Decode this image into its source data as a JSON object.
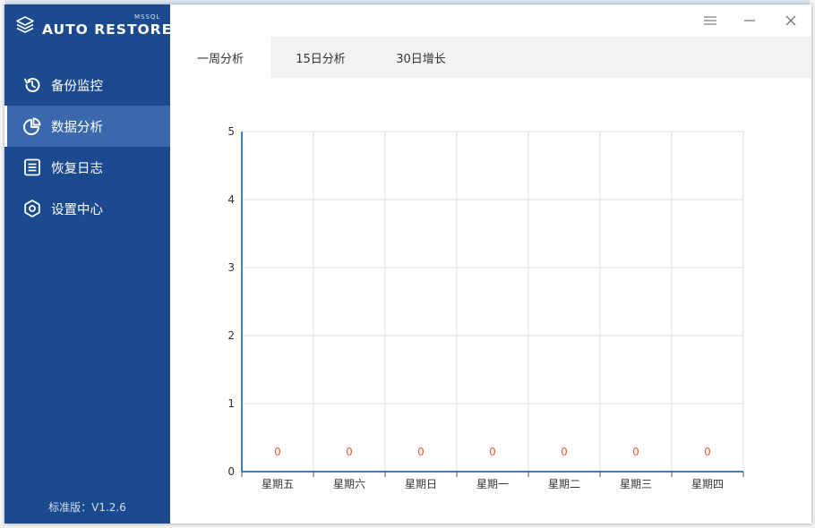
{
  "app": {
    "brand_name": "AUTO RESTORE",
    "brand_sub": "MSSQL",
    "version": "标准版：V1.2.6"
  },
  "sidebar": {
    "items": [
      {
        "label": "备份监控",
        "icon": "history-icon",
        "active": false
      },
      {
        "label": "数据分析",
        "icon": "pie-chart-icon",
        "active": true
      },
      {
        "label": "恢复日志",
        "icon": "log-list-icon",
        "active": false
      },
      {
        "label": "设置中心",
        "icon": "settings-icon",
        "active": false
      }
    ]
  },
  "titlebar": {
    "buttons": [
      "menu-icon",
      "minimize-icon",
      "close-icon"
    ]
  },
  "tabs": [
    {
      "label": "一周分析",
      "active": true
    },
    {
      "label": "15日分析",
      "active": false
    },
    {
      "label": "30日增长",
      "active": false
    }
  ],
  "colors": {
    "sidebar_bg": "#1b4a8e",
    "sidebar_active": "#3a68ad",
    "axis": "#3c7fc7",
    "grid": "#dddddd",
    "data_label": "#e85b4a"
  },
  "chart_data": {
    "type": "bar",
    "categories": [
      "星期五",
      "星期六",
      "星期日",
      "星期一",
      "星期二",
      "星期三",
      "星期四"
    ],
    "values": [
      0,
      0,
      0,
      0,
      0,
      0,
      0
    ],
    "data_labels": [
      "0",
      "0",
      "0",
      "0",
      "0",
      "0",
      "0"
    ],
    "y_ticks": [
      "0",
      "1",
      "2",
      "3",
      "4",
      "5"
    ],
    "ylim": [
      0,
      5
    ],
    "grid": true
  }
}
